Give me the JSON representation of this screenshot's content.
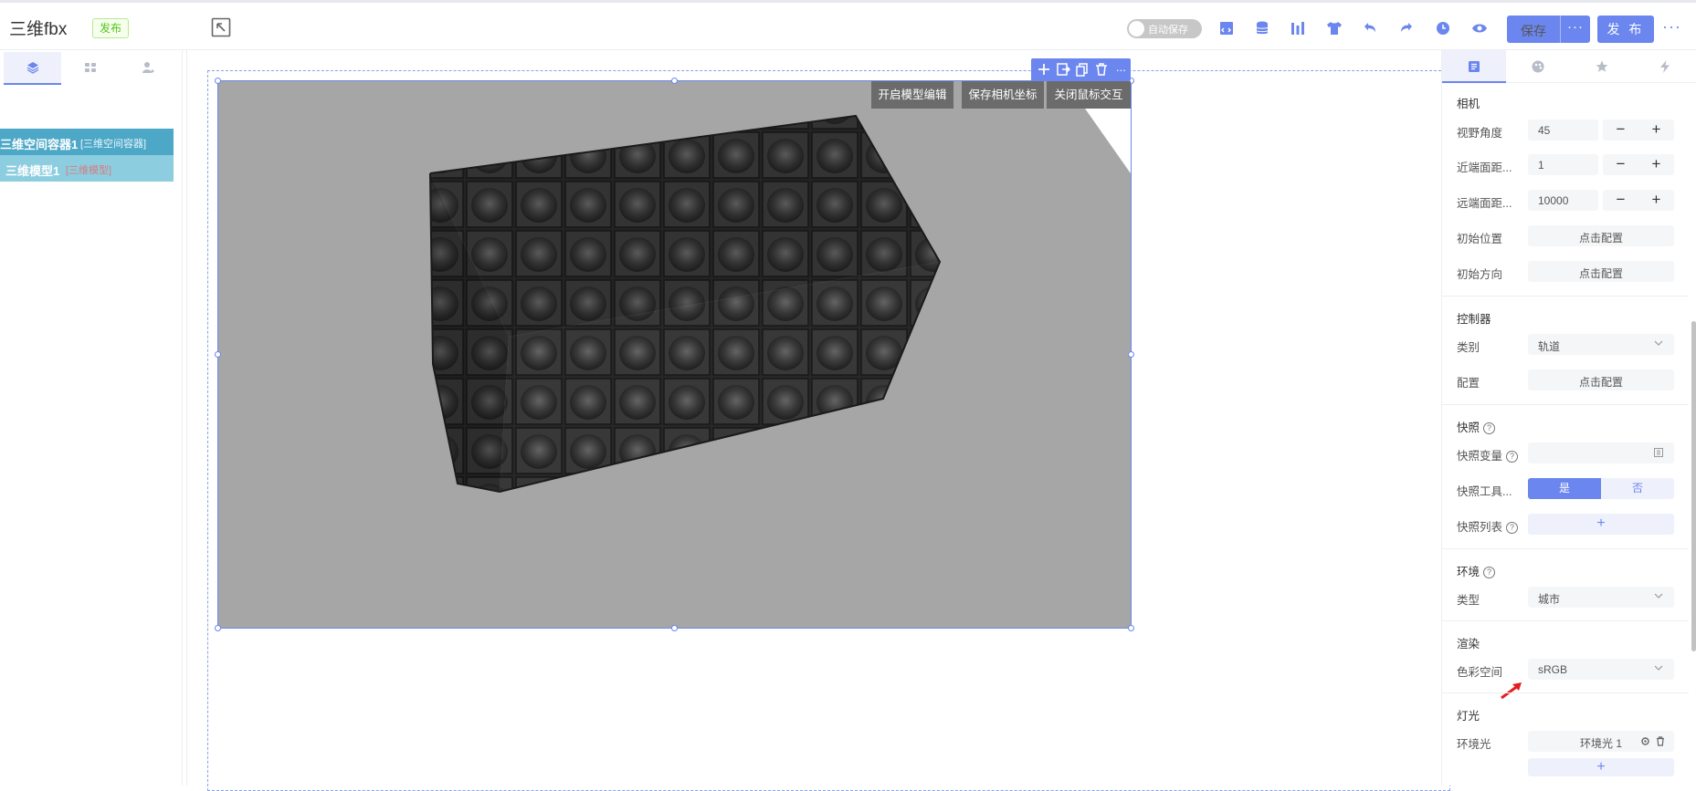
{
  "header": {
    "app_title": "三维fbx",
    "publish_badge": "发布",
    "autosave_label": "自动保存",
    "save_label": "保存",
    "save_more": "···",
    "publish_label": "发 布",
    "more": "···",
    "accent_color": "#6b86ee"
  },
  "left": {
    "tree": [
      {
        "name": "三维空间容器1",
        "type": "[三维空间容器]"
      },
      {
        "name": "三维模型1",
        "type": "[三维模型]"
      }
    ]
  },
  "viewport": {
    "buttons": [
      "开启模型编辑",
      "保存相机坐标",
      "关闭鼠标交互"
    ],
    "toolbar_more": "..."
  },
  "right": {
    "camera": {
      "title": "相机",
      "fov_label": "视野角度",
      "fov_value": "45",
      "near_label": "近端面距...",
      "near_value": "1",
      "far_label": "远端面距...",
      "far_value": "10000",
      "init_pos_label": "初始位置",
      "init_pos_btn": "点击配置",
      "init_dir_label": "初始方向",
      "init_dir_btn": "点击配置"
    },
    "controller": {
      "title": "控制器",
      "type_label": "类别",
      "type_value": "轨道",
      "config_label": "配置",
      "config_btn": "点击配置"
    },
    "snapshot": {
      "title": "快照",
      "var_label": "快照变量",
      "tool_label": "快照工具...",
      "yes": "是",
      "no": "否",
      "list_label": "快照列表",
      "add": "+"
    },
    "environment": {
      "title": "环境",
      "type_label": "类型",
      "type_value": "城市"
    },
    "render": {
      "title": "渲染",
      "colorspace_label": "色彩空间",
      "colorspace_value": "sRGB"
    },
    "light": {
      "title": "灯光",
      "ambient_label": "环境光",
      "ambient_value": "环境光 1",
      "add": "+"
    },
    "stepper_minus": "−",
    "stepper_plus": "+",
    "help_glyph": "?"
  }
}
